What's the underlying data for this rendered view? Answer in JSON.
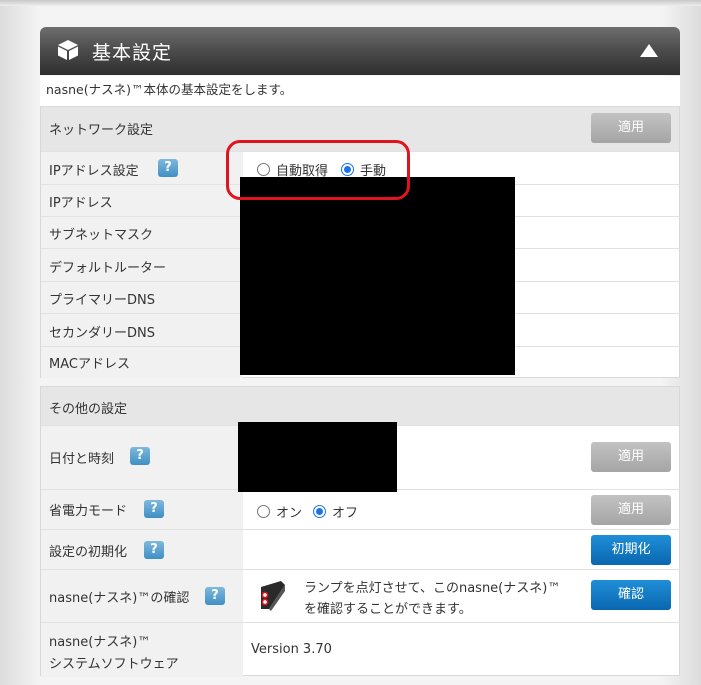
{
  "header": {
    "title": "基本設定"
  },
  "description": "nasne(ナスネ)™本体の基本設定をします。",
  "network": {
    "heading": "ネットワーク設定",
    "apply_label": "適用",
    "rows": {
      "ip_setting": "IPアドレス設定",
      "ip_address": "IPアドレス",
      "subnet": "サブネットマスク",
      "gateway": "デフォルトルーター",
      "dns1": "プライマリーDNS",
      "dns2": "セカンダリーDNS",
      "mac": "MACアドレス"
    },
    "ip_mode_options": {
      "auto": "自動取得",
      "manual": "手動"
    },
    "ip_mode_selected": "手動"
  },
  "other": {
    "heading": "その他の設定",
    "datetime_label": "日付と時刻",
    "datetime_apply": "適用",
    "power_label": "省電力モード",
    "power_options": {
      "on": "オン",
      "off": "オフ"
    },
    "power_selected": "オフ",
    "power_apply": "適用",
    "init_label": "設定の初期化",
    "init_button": "初期化",
    "confirm_label": "nasne(ナスネ)™の確認",
    "confirm_text_1": "ランプを点灯させて、このnasne(ナスネ)™",
    "confirm_text_2": "を確認することができます。",
    "confirm_button": "確認",
    "software_label_1": "nasne(ナスネ)™",
    "software_label_2": "システムソフトウェア",
    "software_version": "Version 3.70"
  },
  "help_glyph": "?",
  "colors": {
    "accent_blue": "#0a66b0",
    "annotation_red": "#e0141e"
  }
}
